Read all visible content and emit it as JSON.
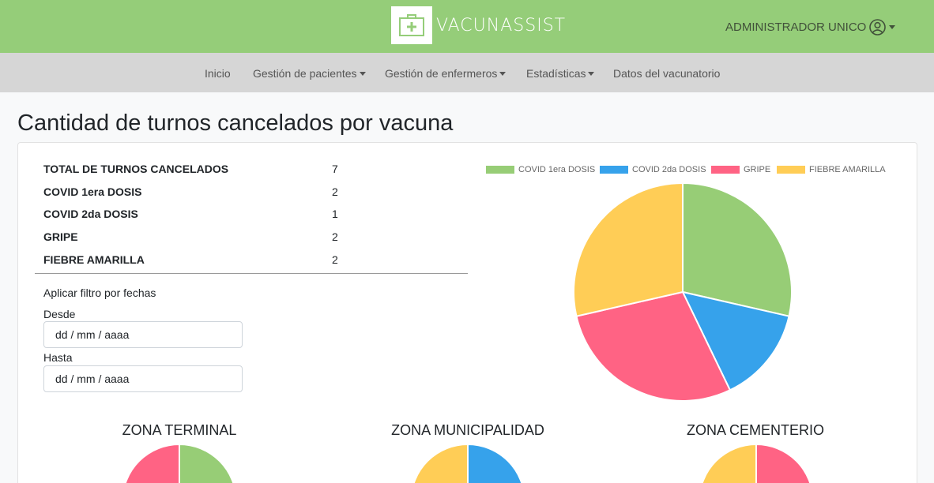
{
  "header": {
    "brand": "VACUNASSIST",
    "user_label": "ADMINISTRADOR UNICO",
    "icons": {
      "logo": "medical-kit-icon",
      "user": "user-circle-icon"
    },
    "colors": {
      "topbar": "#95cd79",
      "navbar": "#d6d6d6"
    }
  },
  "nav": {
    "items": [
      {
        "label": "Inicio",
        "dropdown": false
      },
      {
        "label": "Gestión de pacientes",
        "dropdown": true
      },
      {
        "label": "Gestión de enfermeros",
        "dropdown": true
      },
      {
        "label": "Estadísticas",
        "dropdown": true
      },
      {
        "label": "Datos del vacunatorio",
        "dropdown": false
      }
    ]
  },
  "main": {
    "title": "Cantidad de turnos cancelados por vacuna",
    "stats": [
      {
        "label": "TOTAL DE TURNOS CANCELADOS",
        "value": "7"
      },
      {
        "label": "COVID 1era DOSIS",
        "value": "2"
      },
      {
        "label": "COVID 2da DOSIS",
        "value": "1"
      },
      {
        "label": "GRIPE",
        "value": "2"
      },
      {
        "label": "FIEBRE AMARILLA",
        "value": "2"
      }
    ],
    "filter": {
      "title": "Aplicar filtro por fechas",
      "from_label": "Desde",
      "from_placeholder": "dd / mm / aaaa",
      "to_label": "Hasta",
      "to_placeholder": "dd / mm / aaaa"
    },
    "zones": [
      {
        "title": "ZONA TERMINAL"
      },
      {
        "title": "ZONA MUNICIPALIDAD"
      },
      {
        "title": "ZONA CEMENTERIO"
      }
    ]
  },
  "chart_data": {
    "type": "pie",
    "title": "",
    "categories": [
      "COVID 1era DOSIS",
      "COVID 2da DOSIS",
      "GRIPE",
      "FIEBRE AMARILLA"
    ],
    "values": [
      2,
      1,
      2,
      2
    ],
    "colors": [
      "#97cd76",
      "#36a2eb",
      "#ff6384",
      "#ffcd56"
    ],
    "legend": "top"
  }
}
